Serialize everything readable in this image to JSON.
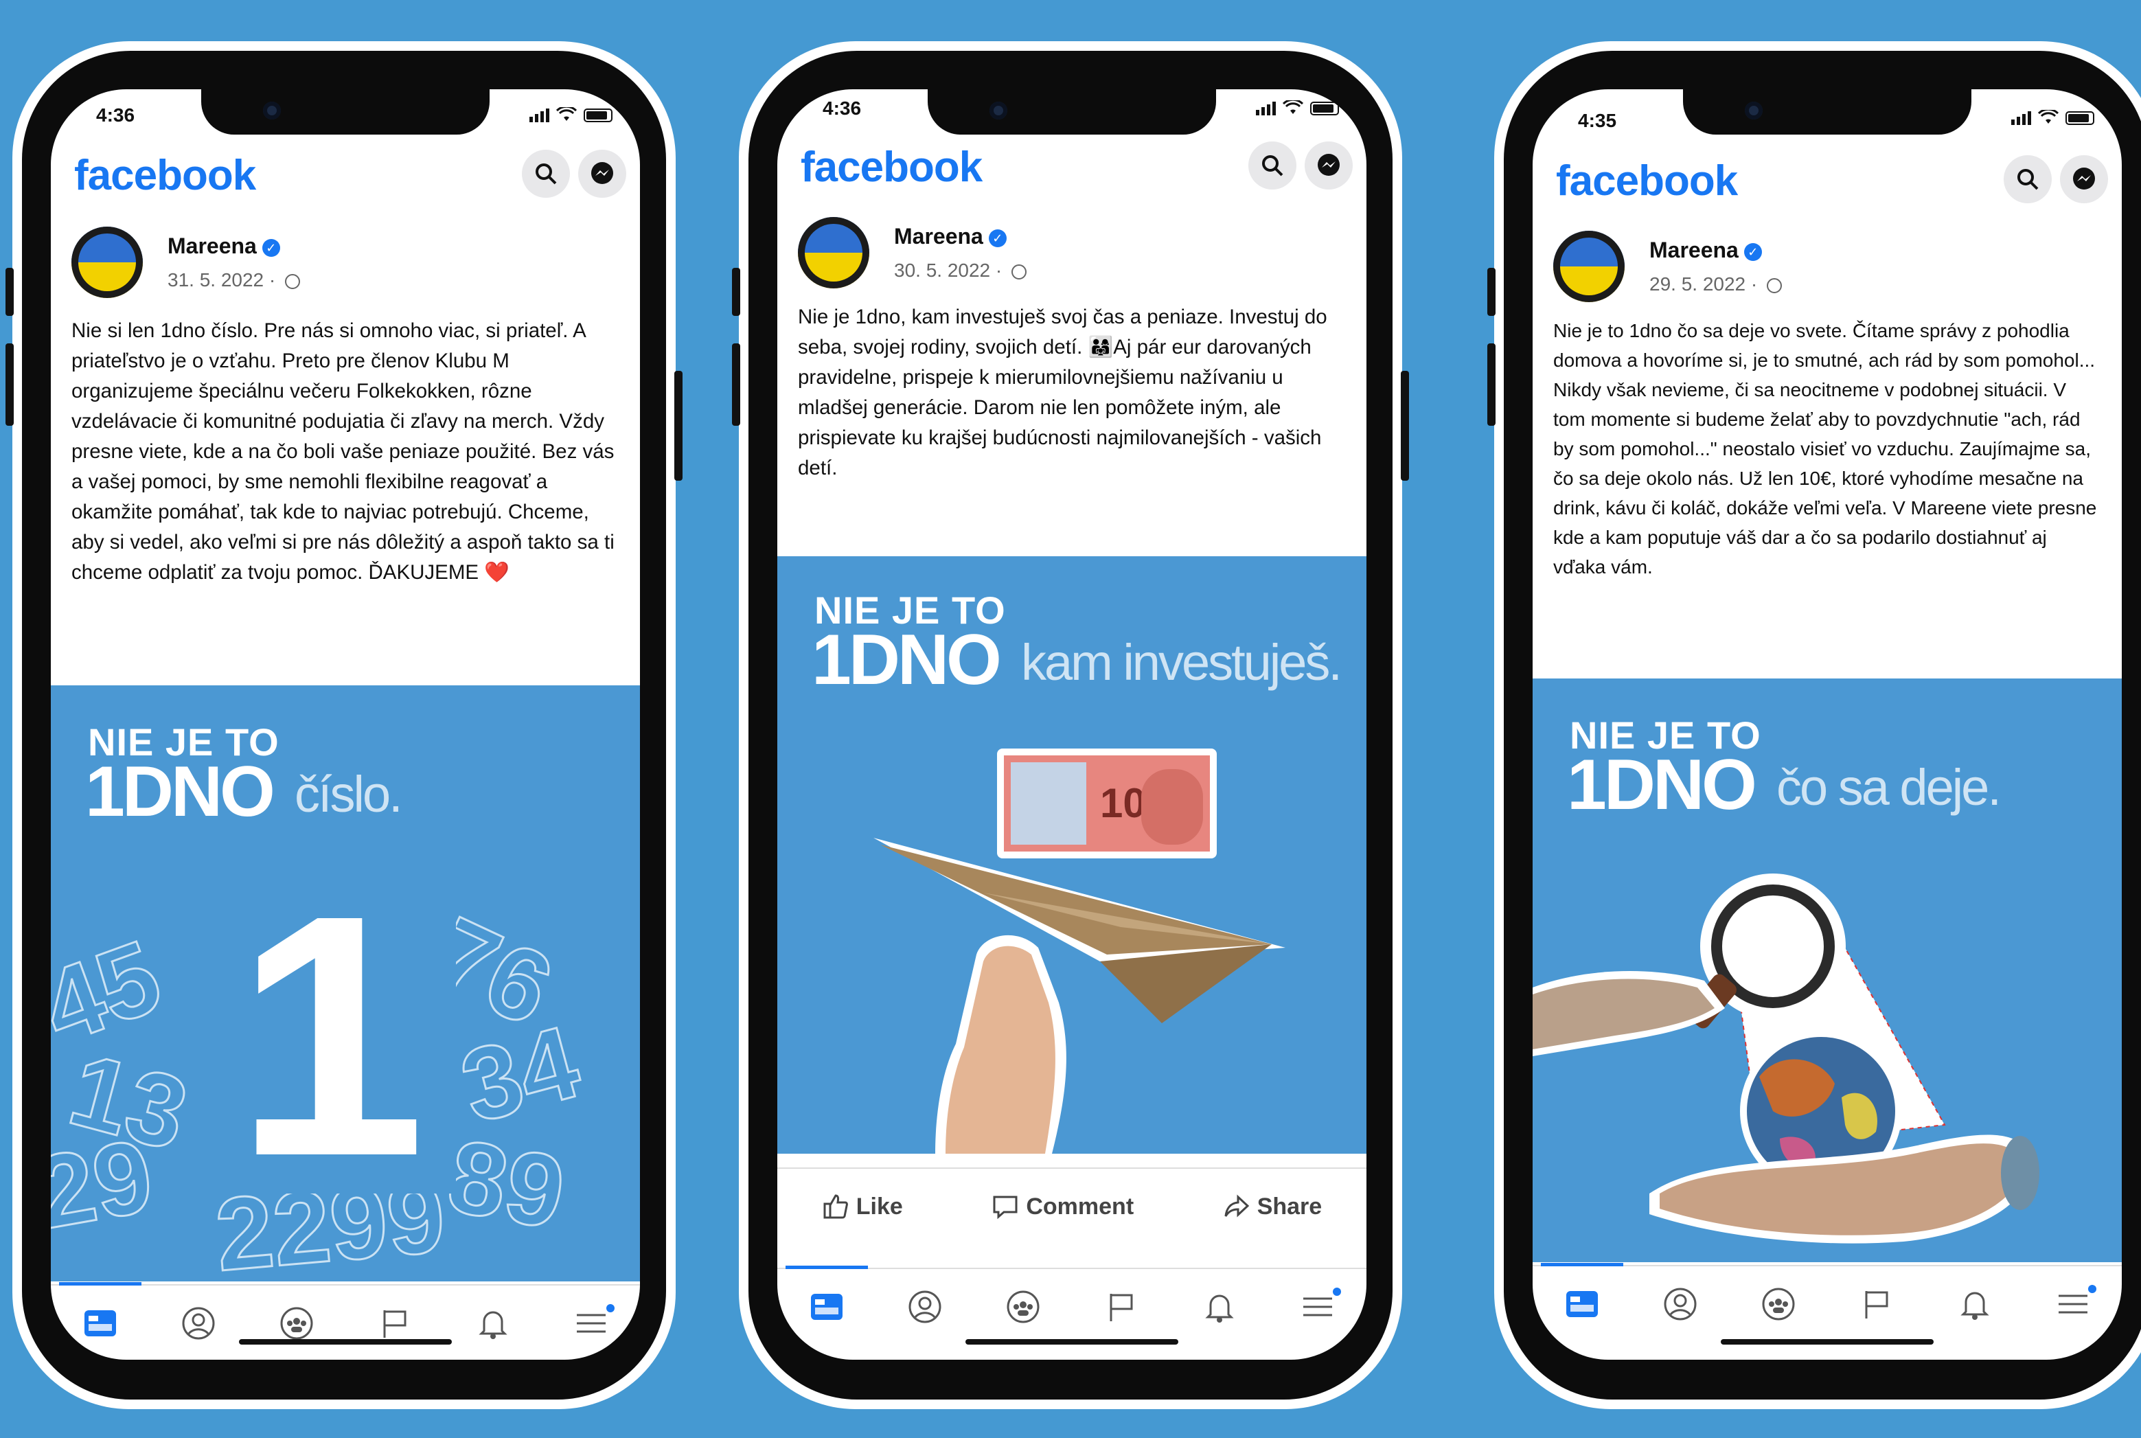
{
  "app": {
    "logo": "facebook"
  },
  "phones": [
    {
      "time": "4:36",
      "author": "Mareena",
      "date": "31. 5. 2022 · ",
      "text": "Nie si len 1dno číslo. Pre nás si omnoho viac, si priateľ. A priateľstvo je o vzťahu. Preto pre členov Klubu M organizujeme špeciálnu večeru Folkekokken, rôzne vzdelávacie či komunitné podujatia či zľavy na merch. Vždy presne viete, kde a na čo boli vaše peniaze použité. Bez vás a vašej pomoci, by sme nemohli flexibilne reagovať a okamžite pomáhať, tak kde to najviac potrebujú. Chceme, aby si vedel, ako veľmi si pre nás dôležitý a aspoň takto sa ti chceme odplatiť za tvoju pomoc. ĎAKUJEME ❤️",
      "image": {
        "line1": "NIE JE TO",
        "line2": "1DNO",
        "tagline": "číslo.",
        "big_number": "1"
      }
    },
    {
      "time": "4:36",
      "author": "Mareena",
      "date": "30. 5. 2022 · ",
      "text": "Nie je 1dno, kam investuješ svoj čas a peniaze. Investuj do seba, svojej rodiny, svojich detí. 👨‍👩‍👧Aj pár eur darovaných pravidelne, prispeje k mierumilovnejšiemu nažívaniu u mladšej generácie. Darom nie len pomôžete iným, ale prispievate ku krajšej budúcnosti najmilovanejších - vašich detí.",
      "image": {
        "line1": "NIE JE TO",
        "line2": "1DNO",
        "tagline": "kam investuješ.",
        "banknote": "10"
      },
      "actions": {
        "like": "Like",
        "comment": "Comment",
        "share": "Share"
      }
    },
    {
      "time": "4:35",
      "author": "Mareena",
      "date": "29. 5. 2022 · ",
      "text": "Nie je to 1dno čo sa deje vo svete. Čítame správy z pohodlia domova a hovoríme si, je to smutné, ach rád by som pomohol... Nikdy však nevieme, či sa neocitneme v podobnej situácii. V tom momente si budeme želať aby to povzdychnutie \"ach, rád by som pomohol...\" neostalo visieť vo vzduchu. Zaujímajme sa, čo sa deje okolo nás. Už len 10€, ktoré vyhodíme mesačne na drink, kávu či koláč, dokáže veľmi veľa. V Mareene viete presne kde a kam poputuje váš dar a čo sa podarilo dostiahnuť aj vďaka vám.",
      "image": {
        "line1": "NIE JE TO",
        "line2": "1DNO",
        "tagline": "čo sa deje."
      }
    }
  ],
  "colors": {
    "background": "#4599d2",
    "brand": "#1877f2",
    "post_image": "#4b98d3"
  }
}
